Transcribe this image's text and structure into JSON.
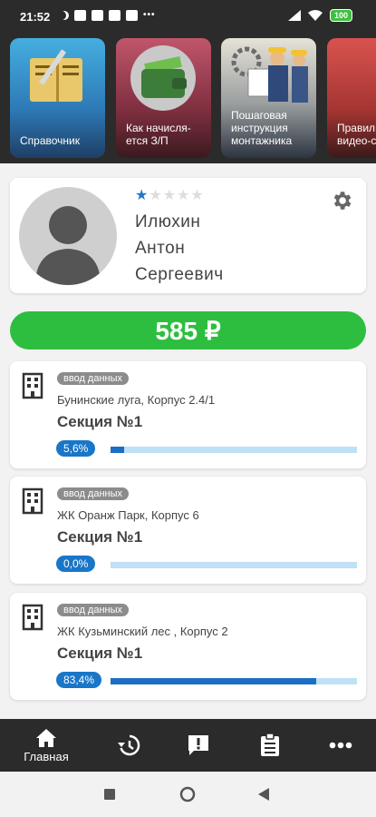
{
  "status": {
    "time": "21:52",
    "battery": "100"
  },
  "header_cards": [
    {
      "label": "Справочник"
    },
    {
      "label": "Как начисля-\nется З/П"
    },
    {
      "label": "Пошаговая\nинструкция\nмонтажника"
    },
    {
      "label": "Правил\nвидео-с"
    }
  ],
  "profile": {
    "rating": 1,
    "rating_max": 5,
    "name_line1": "Илюхин",
    "name_line2": "Антон",
    "name_line3": "Сергеевич"
  },
  "balance": {
    "amount": "585 ₽"
  },
  "objects": [
    {
      "tag": "ввод данных",
      "address": "Бунинские луга, Корпус 2.4/1",
      "section": "Секция №1",
      "percent_label": "5,6%",
      "progress": 0.056
    },
    {
      "tag": "ввод данных",
      "address": "ЖК Оранж Парк, Корпус 6",
      "section": "Секция №1",
      "percent_label": "0,0%",
      "progress": 0.0
    },
    {
      "tag": "ввод данных",
      "address": "ЖК Кузьминский лес , Корпус 2",
      "section": "Секция №1",
      "percent_label": "83,4%",
      "progress": 0.834
    }
  ],
  "bottom_nav": {
    "home_label": "Главная"
  },
  "colors": {
    "accent_green": "#2dbe3f",
    "progress_blue": "#1a6fc4",
    "star_blue": "#2179c9"
  }
}
